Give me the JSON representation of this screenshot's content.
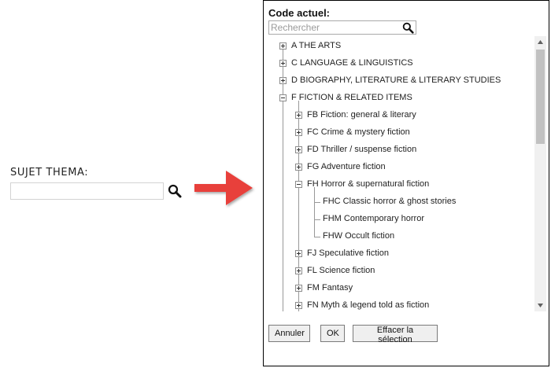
{
  "left": {
    "label": "SUJET THEMA:",
    "input_value": ""
  },
  "dialog": {
    "title": "Code actuel:",
    "search_placeholder": "Rechercher",
    "tree": {
      "A": "A THE ARTS",
      "C": "C LANGUAGE & LINGUISTICS",
      "D": "D BIOGRAPHY, LITERATURE & LITERARY STUDIES",
      "F": "F FICTION & RELATED ITEMS",
      "FB": "FB Fiction: general & literary",
      "FC": "FC Crime & mystery fiction",
      "FD": "FD Thriller / suspense fiction",
      "FG": "FG Adventure fiction",
      "FH": "FH Horror & supernatural fiction",
      "FHC": "FHC Classic horror & ghost stories",
      "FHM": "FHM Contemporary horror",
      "FHW": "FHW Occult fiction",
      "FJ": "FJ Speculative fiction",
      "FL": "FL Science fiction",
      "FM": "FM Fantasy",
      "FN": "FN Myth & legend told as fiction"
    },
    "buttons": {
      "cancel": "Annuler",
      "ok": "OK",
      "clear": "Effacer la sélection"
    }
  },
  "colors": {
    "arrow": "#e8403a",
    "thumb": "#c1c1c1",
    "button_bg": "#efefef"
  }
}
